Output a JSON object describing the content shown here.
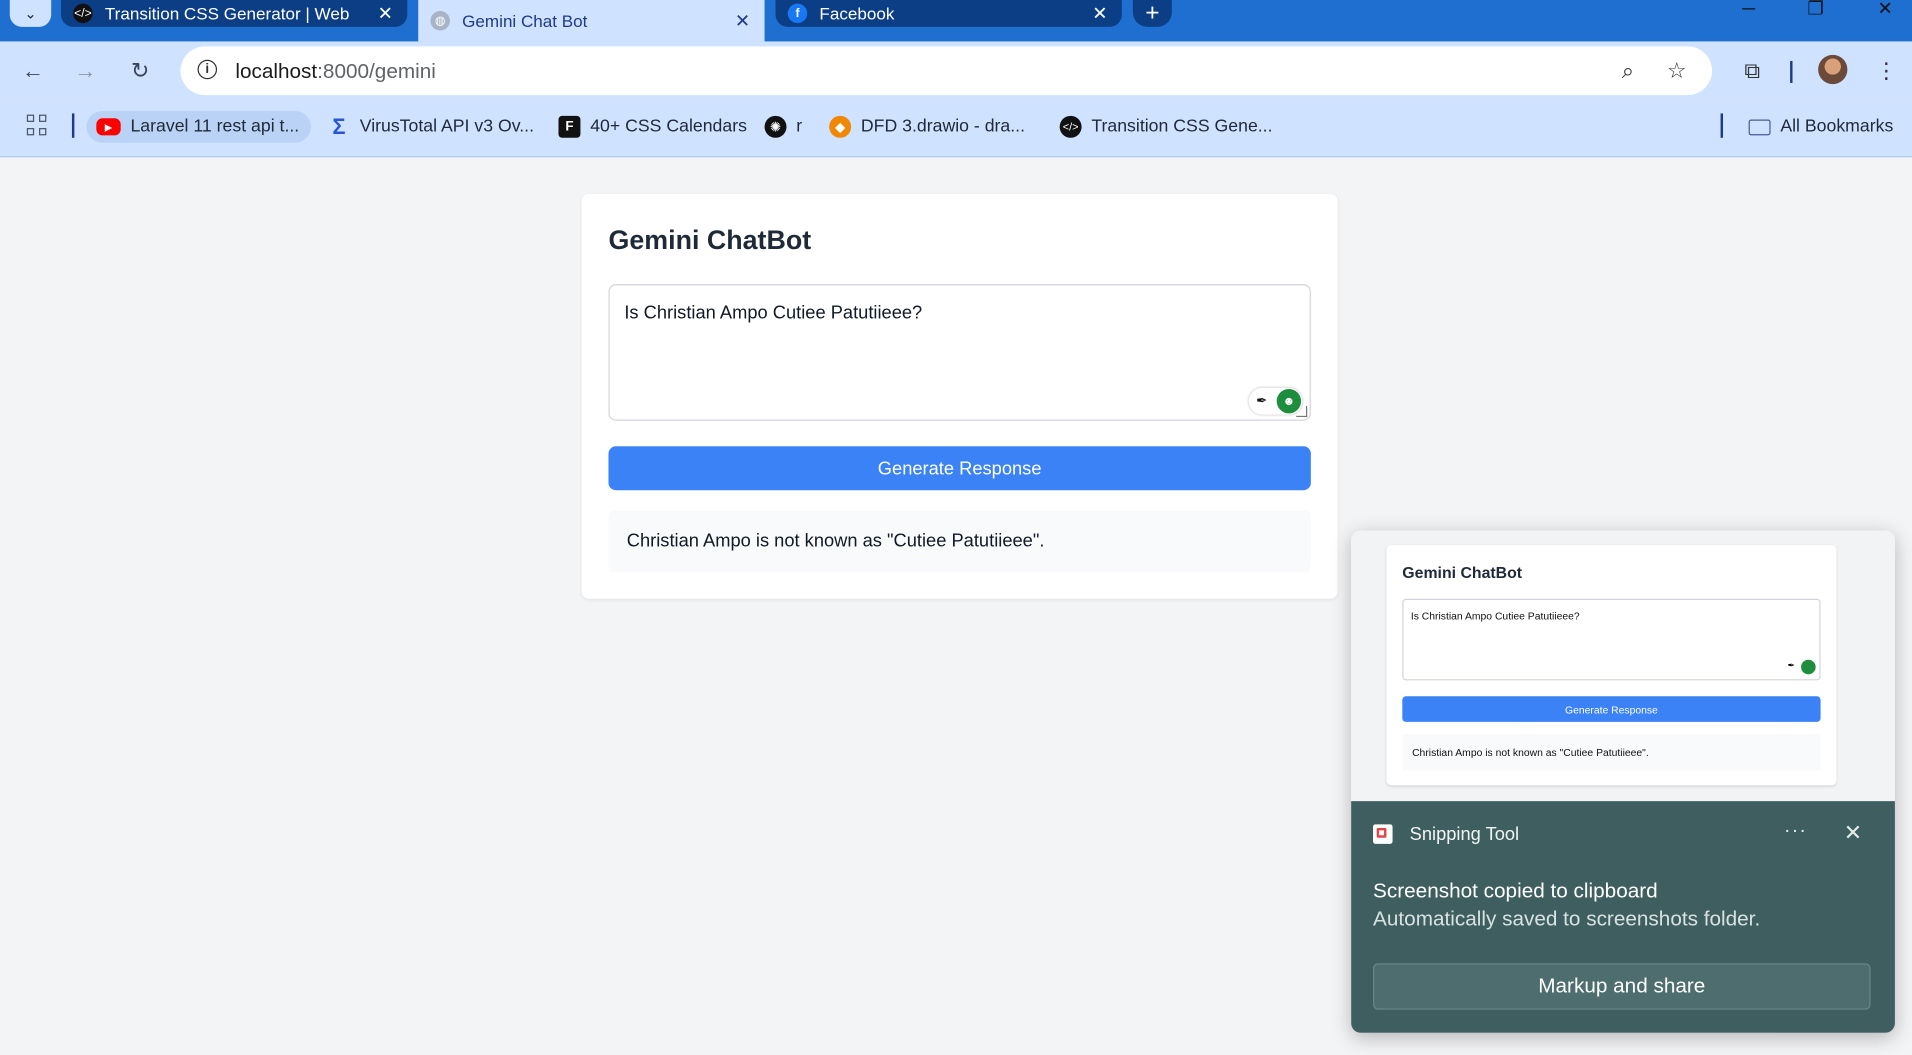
{
  "browser": {
    "tabs": [
      {
        "title": "Transition CSS Generator | Web",
        "icon": "code-icon"
      },
      {
        "title": "Gemini Chat Bot",
        "icon": "globe-icon"
      },
      {
        "title": "Facebook",
        "icon": "facebook-icon"
      }
    ],
    "address": {
      "host": "localhost",
      "path": ":8000/gemini"
    },
    "bookmarks": [
      {
        "label": "Laravel 11 rest api t...",
        "icon": "youtube-icon"
      },
      {
        "label": "VirusTotal API v3 Ov...",
        "icon": "sigma-icon"
      },
      {
        "label": "40+ CSS Calendars",
        "icon": "f-icon"
      },
      {
        "label": "r",
        "icon": "openai-icon"
      },
      {
        "label": "DFD 3.drawio - dra...",
        "icon": "drawio-icon"
      },
      {
        "label": "Transition CSS Gene...",
        "icon": "code-icon"
      }
    ],
    "all_bookmarks": "All Bookmarks"
  },
  "page": {
    "title": "Gemini ChatBot",
    "prompt": "Is Christian Ampo Cutiee Patutiieee?",
    "button": "Generate Response",
    "response": "Christian Ampo is not known as \"Cutiee Patutiieee\"."
  },
  "toast": {
    "app_name": "Snipping Tool",
    "heading": "Screenshot copied to clipboard",
    "subtext": "Automatically saved to screenshots folder.",
    "action": "Markup and share",
    "more": "···",
    "close": "✕"
  },
  "colors": {
    "accent": "#3b82f6",
    "toolbar": "#cfe2ff",
    "tabstrip": "#1e6fd0",
    "toast": "#3f5e60"
  }
}
